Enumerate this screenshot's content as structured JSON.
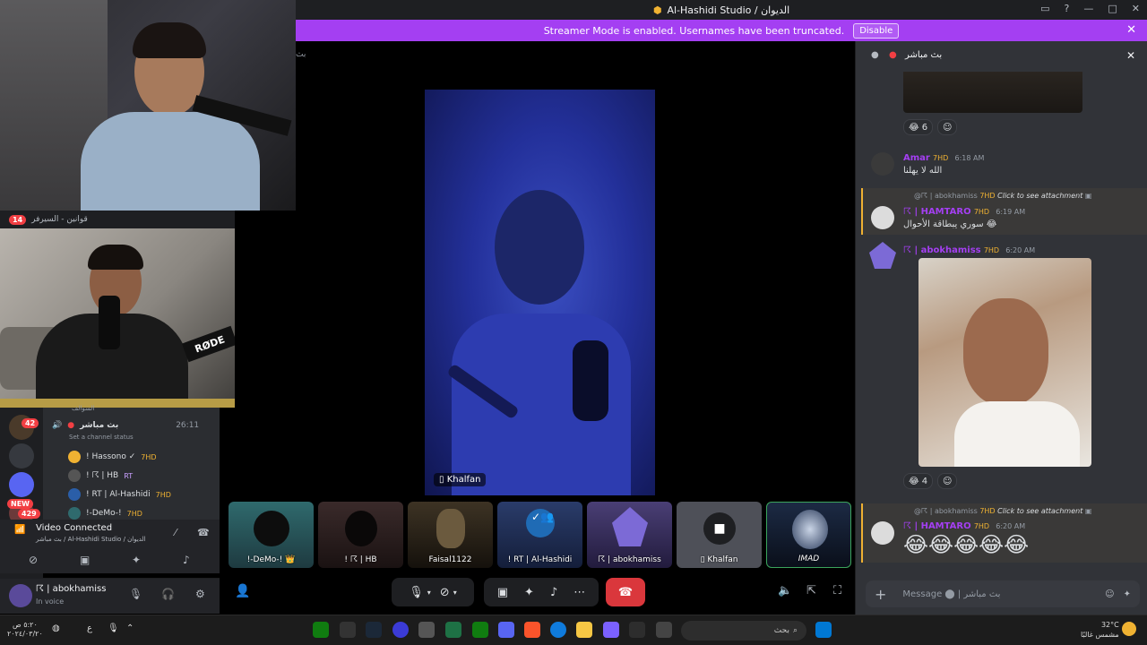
{
  "window": {
    "title": "Al-Hashidi Studio / الديوان",
    "controls": [
      "□",
      "?",
      "—",
      "□",
      "✕"
    ]
  },
  "streamer_banner": {
    "text": "Streamer Mode is enabled. Usernames have been truncated.",
    "button": "Disable",
    "close": "✕"
  },
  "sidebar_strip": {
    "badge": "14",
    "label": "قوانين - السيرفر"
  },
  "servers": {
    "badge_42": "42",
    "badge_new": "NEW",
    "badge_429": "429"
  },
  "voice_channel": {
    "category": "السوالف",
    "channel_name": "بث مباشر",
    "timer": "26:11",
    "status": "Set a channel status",
    "members": [
      {
        "name": "! Hassono ✓",
        "tag": "7HD"
      },
      {
        "name": "! ☈ | HB",
        "tag": "RT"
      },
      {
        "name": "! RT | Al-Hashidi",
        "tag": "7HD"
      },
      {
        "name": "!-DeMo-!",
        "tag": "7HD"
      }
    ]
  },
  "voice_connected": {
    "title": "Video Connected",
    "subtitle": "بث مباشر / Al-Hashidi Studio / الديوان"
  },
  "user_panel": {
    "name": "☈ | abokhamiss",
    "status": "In voice"
  },
  "stage": {
    "top_label": "بث",
    "main_label": "Khalfan",
    "tiles": [
      {
        "label": "!-DeMo-! 👑"
      },
      {
        "label": "! ☈ | HB"
      },
      {
        "label": "Faisal1122"
      },
      {
        "label": "! RT | Al-Hashidi"
      },
      {
        "label": "☈ | abokhamiss"
      },
      {
        "label": "Khalfan"
      },
      {
        "label": "IMAD"
      }
    ]
  },
  "chat": {
    "header": "بث مباشر",
    "reaction1_count": "6",
    "reaction2_count": "4",
    "messages": [
      {
        "user": "Amar",
        "tag": "7HD",
        "time": "6:18 AM",
        "text": "الله لا يهلنا"
      },
      {
        "reply_user": "@☈ | abokhamiss",
        "reply_tag": "7HD",
        "reply_text": "Click to see attachment",
        "user": "☈ | HAMTARO",
        "tag": "7HD",
        "time": "6:19 AM",
        "text": "سوري يبطاقة الأحوال 😂"
      },
      {
        "user": "☈ | abokhamiss",
        "tag": "7HD",
        "time": "6:20 AM"
      },
      {
        "reply_user": "@☈ | abokhamiss",
        "reply_tag": "7HD",
        "reply_text": "Click to see attachment",
        "user": "☈ | HAMTARO",
        "tag": "7HD",
        "time": "6:20 AM",
        "text": "😂😂😂😂😂"
      }
    ],
    "input_placeholder": "Message ⬤ | بث مباشر"
  },
  "taskbar": {
    "search_placeholder": "بحث",
    "time": "٥:٢٠ ص",
    "date": "٢٠٢٤/٠٣/٢٠",
    "weather_temp": "32°C",
    "weather_desc": "مشمس غالبًا",
    "lang": "ع"
  }
}
